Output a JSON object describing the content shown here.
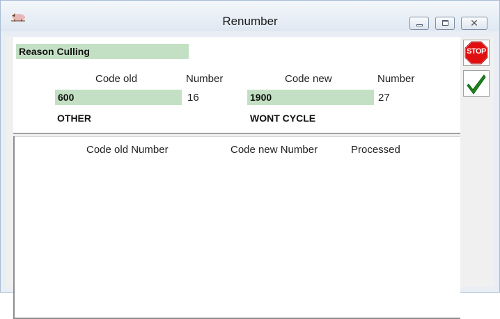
{
  "window": {
    "title": "Renumber",
    "close_glyph": "✕",
    "icon": "pig-icon"
  },
  "reason": {
    "label": "Reason Culling"
  },
  "codes": {
    "col_code_old": "Code old",
    "col_number_old": "Number",
    "col_code_new": "Code new",
    "col_number_new": "Number",
    "old_code": "600",
    "old_number": "16",
    "old_desc": "OTHER",
    "new_code": "1900",
    "new_number": "27",
    "new_desc": "WONT CYCLE"
  },
  "results": {
    "headers": [
      "Code old Number",
      "Code new Number",
      "Processed"
    ]
  },
  "actions": {
    "stop_label": "STOP",
    "stop_color": "#e01010",
    "ok_icon": "checkmark-icon",
    "ok_color": "#1a8a1a"
  },
  "colors": {
    "field_green": "#c4e0c4"
  }
}
